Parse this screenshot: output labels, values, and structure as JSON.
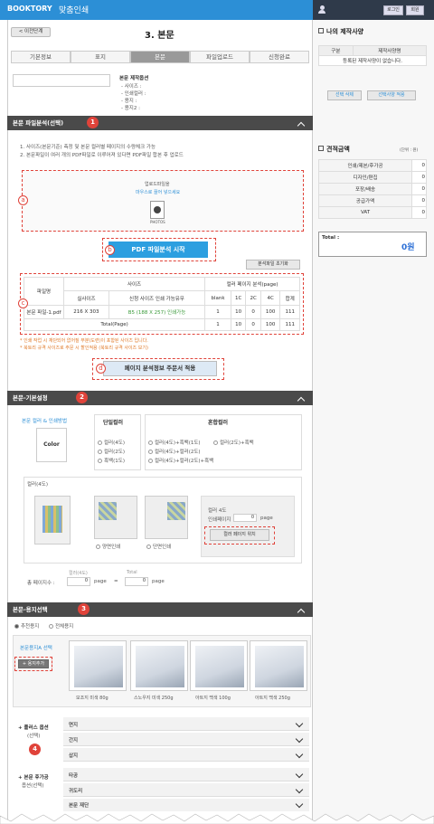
{
  "header": {
    "brand": "BOOKTORY",
    "app_title": "맞춤인쇄",
    "login": "로그인",
    "signup": "회원"
  },
  "page": {
    "back": "< 이전단계",
    "title": "3. 본문"
  },
  "steps": [
    "기본정보",
    "표지",
    "본문",
    "파일업로드",
    "신청완료"
  ],
  "info": {
    "title": "본문 제작옵션",
    "lines": [
      "- 사이즈 :",
      "- 인쇄컬러 :",
      "- 용지 :",
      "- 용지2 :"
    ]
  },
  "sec1": {
    "title": "본문 파일분석(선택)",
    "num": "1",
    "notes": [
      "1. 사이즈(본문기준) 측정 및 본문 컬러별 페이지의 수량체크 가능",
      "2. 본문파일이 여러 개의 PDF파일로 이루어져 있다면 PDF파일 합본 후 업로드"
    ],
    "drop": "업로드파일을",
    "drop2": "마우스로 끌어 넣으세요",
    "pdf_label": "PHOTOS",
    "mark_a": "a",
    "mark_b": "b",
    "mark_c": "c",
    "mark_d": "d",
    "analyze_btn": "PDF 파일분석 시작",
    "reset_btn": "분석파일 초기화",
    "table": {
      "h_file": "파일명",
      "h_size": "사이즈",
      "h_actual": "실사이즈",
      "h_print": "신청 사이즈 인쇄 가능유무",
      "h_color": "컬러 페이지 분석(page)",
      "h_cols": [
        "blank",
        "1C",
        "2C",
        "4C",
        "합계"
      ],
      "row": {
        "file": "본문 파일-1.pdf",
        "actual": "216 X 303",
        "print": "B5 (188 X 257) 인쇄가능",
        "vals": [
          "1",
          "10",
          "0",
          "100",
          "111"
        ]
      },
      "total_label": "Total(Page)",
      "total_vals": [
        "1",
        "10",
        "0",
        "100",
        "111"
      ]
    },
    "warn1": "* 인쇄 작업 시 재단되어 없어질 부분(도련)이 포함된 사이즈 입니다.",
    "warn2": "* 북토리 규격 사이즈로 주문 시 할인적용 (북토리 규격 사이즈 보기)",
    "apply_btn": "페이지 분석정보 주문서 적용"
  },
  "sec2": {
    "title": "본문-기본설정",
    "num": "2",
    "color_label": "본문 컬러 & 인쇄방법",
    "color_box": "Color",
    "single": "단일컬러",
    "mixed": "혼합컬러",
    "single_opts": [
      "컬러(4도)",
      "컬러(2도)",
      "흑백(1도)"
    ],
    "mixed_opts": [
      "컬러(4도)+흑백(1도)",
      "컬러(2도)+흑백",
      "컬러(4도)+컬러(2도)",
      "컬러(4도)+컬러(2도)+흑백"
    ],
    "sub": "컬러(4도)",
    "both": "양면인쇄",
    "single_side": "단면인쇄",
    "side_title": "컬러 4도",
    "side_page": "인쇄페이지",
    "page_val": "0",
    "page_unit": "page",
    "pos_btn": "컬러 페이지 위치",
    "total_label": "총 페이지수 :",
    "tot_a_label": "컬러(4도)",
    "tot_b_label": "Total",
    "tot_a": "0",
    "tot_b": "0",
    "page": "page"
  },
  "sec3": {
    "title": "본문-용지선택",
    "num": "3",
    "r1": "추천용지",
    "r2": "전체용지",
    "paper_label": "본문용지A 선택",
    "add_btn": "+ 용지추가",
    "papers": [
      "모조지 미색 80g",
      "스노우지 미색 250g",
      "아트지 백색 100g",
      "아트지 백색 250g"
    ]
  },
  "sec4": {
    "num": "4",
    "plus_title": "+ 플러스 옵션",
    "plus_sub": "(선택)",
    "plus_items": [
      "면지",
      "간지",
      "삽지"
    ],
    "post_title": "+ 본문 후가공",
    "post_sub": "옵션(선택)",
    "post_items": [
      "타공",
      "귀도리",
      "본문 재단"
    ]
  },
  "side": {
    "my_title": "나의 제작사양",
    "my_h1": "구분",
    "my_h2": "제작사양명",
    "my_empty": "등록된 제작사양이 없습니다.",
    "del_btn": "선택 삭제",
    "apply_btn": "선택사양 적용",
    "est_title": "견적금액",
    "est_unit": "(단위 : 원)",
    "rows": [
      {
        "k": "인쇄/제본/후가공",
        "v": "0"
      },
      {
        "k": "디자인/편집",
        "v": "0"
      },
      {
        "k": "포장/배송",
        "v": "0"
      },
      {
        "k": "공급가액",
        "v": "0"
      },
      {
        "k": "VAT",
        "v": "0"
      }
    ],
    "total_label": "Total :",
    "total_val": "0원"
  }
}
